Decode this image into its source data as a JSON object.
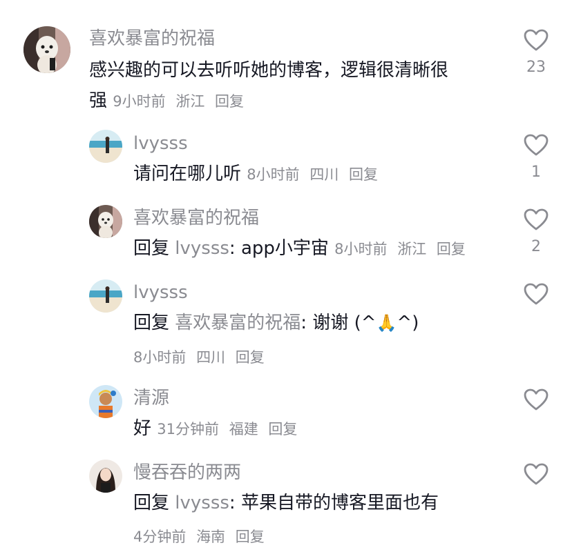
{
  "comments": [
    {
      "user": "喜欢暴富的祝福",
      "text": "感兴趣的可以去听听她的博客，逻辑很清晰很强",
      "text_line1": "感兴趣的可以去听听她的博客，逻辑很清晰很",
      "text_line2": "强",
      "time": "9小时前",
      "location": "浙江",
      "reply": "回复",
      "likes": "23"
    },
    {
      "user": "lvysss",
      "text": "请问在哪儿听",
      "time": "8小时前",
      "location": "四川",
      "reply": "回复",
      "likes": "1"
    },
    {
      "user": "喜欢暴富的祝福",
      "prefix": "回复",
      "target": "lvysss",
      "text": ": app小宇宙",
      "time": "8小时前",
      "location": "浙江",
      "reply": "回复",
      "likes": "2"
    },
    {
      "user": "lvysss",
      "prefix": "回复",
      "target": "喜欢暴富的祝福",
      "text_before": ": 谢谢 (^",
      "emoji": "🙏",
      "text_after": "^)",
      "time": "8小时前",
      "location": "四川",
      "reply": "回复",
      "likes": ""
    },
    {
      "user": "清源",
      "text": "好",
      "time": "31分钟前",
      "location": "福建",
      "reply": "回复",
      "likes": ""
    },
    {
      "user": "慢吞吞的两两",
      "prefix": "回复",
      "target": "lvysss",
      "text": ": 苹果自带的博客里面也有",
      "time": "4分钟前",
      "location": "海南",
      "reply": "回复",
      "likes": ""
    }
  ],
  "colors": {
    "text": "#161823",
    "secondary": "#8a8b91",
    "heart_outline": "#8a8b91"
  },
  "icons": {
    "like": "heart-outline-icon"
  }
}
